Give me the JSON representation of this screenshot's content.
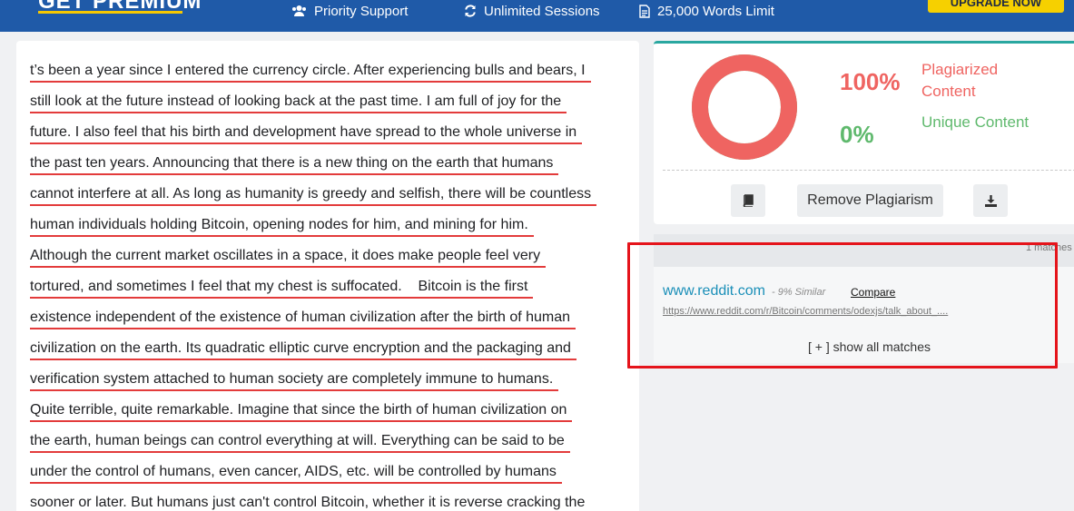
{
  "banner": {
    "brand": "GET PREMIUM",
    "features": [
      {
        "icon": "users-icon",
        "label": "Priority Support"
      },
      {
        "icon": "sync-icon",
        "label": "Unlimited Sessions"
      },
      {
        "icon": "document-icon",
        "label": "25,000 Words Limit"
      }
    ],
    "upgrade_label": "UPGRADE NOW"
  },
  "text_panel": {
    "lines": [
      "t’s been a year since I entered the currency circle. After experiencing bulls and bears, I",
      "still look at the future instead of looking back at the past time. I am full of joy for the",
      "future. I also feel that his birth and development have spread to the whole universe in",
      "the past ten years. Announcing that there is a new thing on the earth that humans",
      "cannot interfere at all. As long as humanity is greedy and selfish, there will be countless",
      "human individuals holding Bitcoin, opening nodes for him, and mining for him.",
      "Although the current market oscillates in a space, it does make people feel very",
      "tortured, and sometimes I feel that my chest is suffocated.    Bitcoin is the first",
      "existence independent of the existence of human civilization after the birth of human",
      "civilization on the earth. Its quadratic elliptic curve encryption and the packaging and",
      "verification system attached to human society are completely immune to humans.",
      "Quite terrible, quite remarkable. Imagine that since the birth of human civilization on",
      "the earth, human beings can control everything at will. Everything can be said to be",
      "under the control of humans, even cancer, AIDS, etc. will be controlled by humans",
      "sooner or later. But humans just can't control Bitcoin, whether it is reverse cracking the"
    ]
  },
  "result": {
    "plagiarized_pct": "100%",
    "plagiarized_label": "Plagiarized Content",
    "unique_pct": "0%",
    "unique_label": "Unique Content",
    "plagiarized_fraction": 1.0,
    "colors": {
      "plagiarized": "#ef6461",
      "unique": "#5fb96d",
      "accent": "#2aa7a0"
    },
    "buttons": {
      "book_icon": "book-icon",
      "remove_label": "Remove Plagiarism",
      "download_icon": "download-icon"
    }
  },
  "matches": {
    "count_label": "1 matches",
    "items": [
      {
        "site": "www.reddit.com",
        "similarity": "- 9% Similar",
        "compare_label": "Compare",
        "url": "https://www.reddit.com/r/Bitcoin/comments/odexjs/talk_about_...."
      }
    ],
    "show_all_label": "[ + ] show all matches"
  }
}
